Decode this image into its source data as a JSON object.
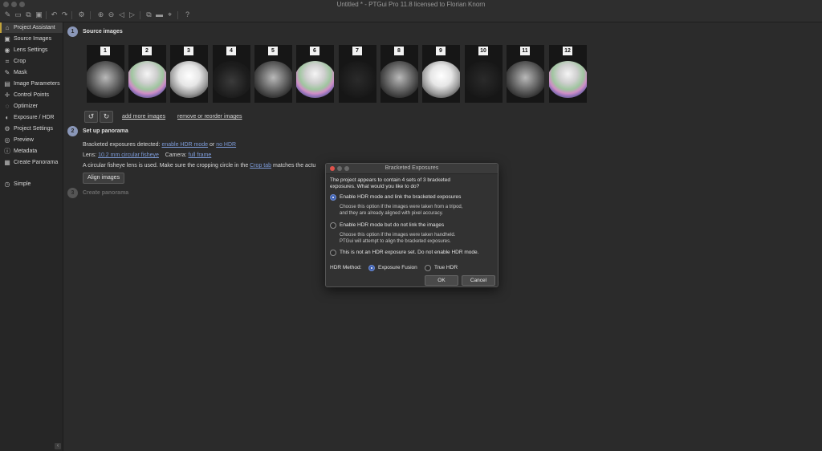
{
  "window": {
    "title": "Untitled * - PTGui Pro 11.8 licensed to Florian Knorn"
  },
  "toolbar": {
    "icons": [
      "new-project-icon",
      "open-icon",
      "save-as-icon",
      "save-icon",
      "undo-icon",
      "redo-icon",
      "settings-icon",
      "zoom-in-icon",
      "zoom-out-icon",
      "rewind-icon",
      "forward-icon",
      "panorama-editor-icon",
      "display-icon",
      "location-icon",
      "help-icon"
    ]
  },
  "sidebar": {
    "items": [
      {
        "label": "Project Assistant",
        "icon": "⌂",
        "active": true
      },
      {
        "label": "Source Images",
        "icon": "▣"
      },
      {
        "label": "Lens Settings",
        "icon": "◉"
      },
      {
        "label": "Crop",
        "icon": "⌗"
      },
      {
        "label": "Mask",
        "icon": "✎"
      },
      {
        "label": "Image Parameters",
        "icon": "▤"
      },
      {
        "label": "Control Points",
        "icon": "✛"
      },
      {
        "label": "Optimizer",
        "icon": "◌"
      },
      {
        "label": "Exposure / HDR",
        "icon": "◐"
      },
      {
        "label": "Project Settings",
        "icon": "⚙"
      },
      {
        "label": "Preview",
        "icon": "◎"
      },
      {
        "label": "Metadata",
        "icon": "ⓘ"
      },
      {
        "label": "Create Panorama",
        "icon": "▦"
      }
    ],
    "simple": {
      "label": "Simple",
      "icon": "◷"
    }
  },
  "main": {
    "step1": {
      "number": "1",
      "title": "Source images"
    },
    "thumbnails": [
      {
        "num": "1",
        "style": "p-mid"
      },
      {
        "num": "2",
        "style": "p-rainbow"
      },
      {
        "num": "3",
        "style": "p-bright"
      },
      {
        "num": "4",
        "style": "p-dark"
      },
      {
        "num": "5",
        "style": "p-mid"
      },
      {
        "num": "6",
        "style": "p-rainbow"
      },
      {
        "num": "7",
        "style": "p-faint"
      },
      {
        "num": "8",
        "style": "p-mid"
      },
      {
        "num": "9",
        "style": "p-bright"
      },
      {
        "num": "10",
        "style": "p-faint"
      },
      {
        "num": "11",
        "style": "p-mid"
      },
      {
        "num": "12",
        "style": "p-rainbow"
      }
    ],
    "add_more_images": "add more images",
    "remove_reorder": "remove or reorder images",
    "step2": {
      "number": "2",
      "title": "Set up panorama"
    },
    "bracketed_label": "Bracketed exposures detected:",
    "enable_hdr_link": "enable HDR mode",
    "or_text": "or",
    "no_hdr_link": "no HDR",
    "lens_label": "Lens:",
    "lens_value": "10.2 mm circular fisheye",
    "camera_label": "Camera:",
    "camera_value": "full frame",
    "fisheye_note_pre": "A circular fisheye lens is used. Make sure the cropping circle in the",
    "crop_tab_link": "Crop tab",
    "fisheye_note_post": "matches the actu",
    "align_images": "Align images",
    "step3": {
      "number": "3",
      "title": "Create panorama"
    }
  },
  "dialog": {
    "title": "Bracketed Exposures",
    "message_line1": "The project appears to contain 4 sets of 3 bracketed",
    "message_line2": "exposures. What would you like to do?",
    "option1": "Enable HDR mode and link the bracketed exposures",
    "option1_desc1": "Choose this option if the images were taken from a tripod,",
    "option1_desc2": "and they are already aligned with pixel accuracy.",
    "option2": "Enable HDR mode but do not link the images",
    "option2_desc1": "Choose this option if the images were taken handheld.",
    "option2_desc2": "PTGui will attempt to align the bracketed exposures.",
    "option3": "This is not an HDR exposure set. Do not enable HDR mode.",
    "hdr_method_label": "HDR Method:",
    "method_fusion": "Exposure Fusion",
    "method_true": "True HDR",
    "ok": "OK",
    "cancel": "Cancel"
  }
}
